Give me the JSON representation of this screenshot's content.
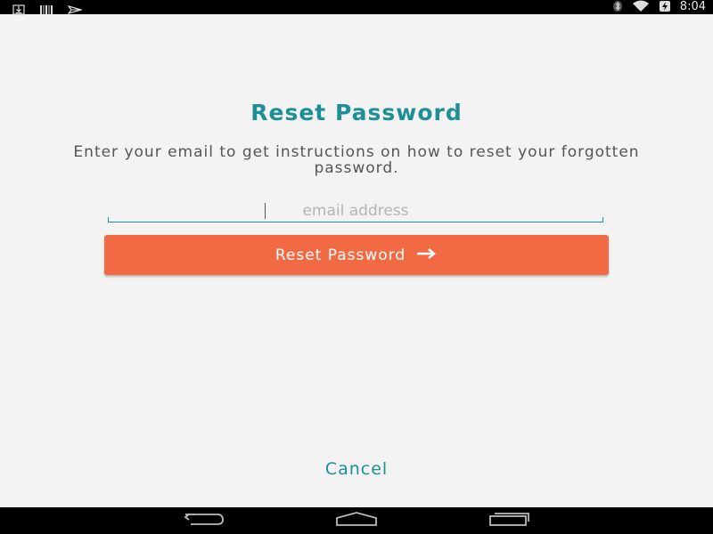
{
  "status_bar": {
    "time": "8:04",
    "left_icons": [
      "download-icon",
      "barcode-icon",
      "send-icon"
    ],
    "right_icons": [
      "bluetooth-icon",
      "wifi-icon",
      "battery-icon"
    ]
  },
  "reset": {
    "title": "Reset Password",
    "instructions": "Enter your email to get instructions on how to reset your forgotten password.",
    "email_placeholder": "email address",
    "email_value": "",
    "button_label": "Reset Password",
    "button_icon": "arrow-right-icon",
    "cancel_label": "Cancel"
  },
  "nav_bar": {
    "buttons": [
      "back-icon",
      "home-icon",
      "recents-icon"
    ]
  },
  "colors": {
    "accent": "#1d8f96",
    "button": "#f26a43",
    "background": "#f3f3f3"
  }
}
